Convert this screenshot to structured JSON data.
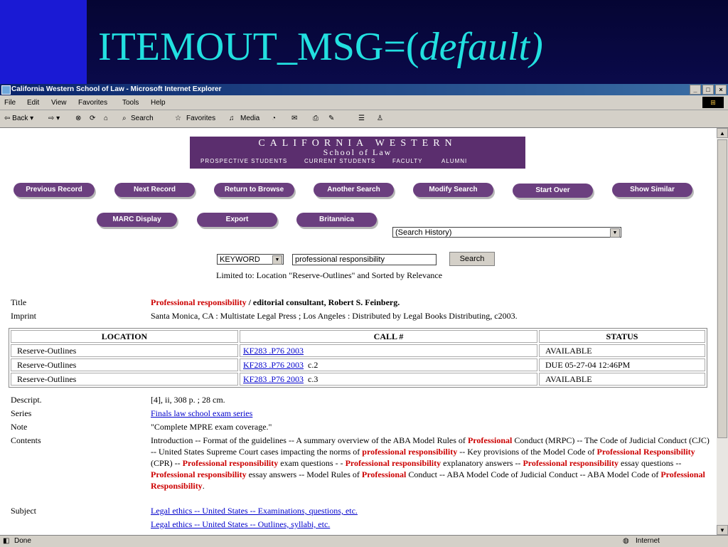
{
  "slide": {
    "title_main": "ITEMOUT_MSG=(",
    "title_italic": "default)"
  },
  "browser": {
    "title": "California Western School of Law - Microsoft Internet Explorer",
    "window_buttons": [
      "_",
      "□",
      "×"
    ],
    "menus": [
      "File",
      "Edit",
      "View",
      "Favorites",
      "Tools",
      "Help"
    ],
    "toolbar": {
      "back": "⇦ Back ▾",
      "forward": "⇨ ▾",
      "search": "Search",
      "favorites": "Favorites",
      "media": "Media"
    },
    "status_left": "Done",
    "status_zone": "Internet"
  },
  "banner": {
    "line1": "CALIFORNIA WESTERN",
    "line2": "School of Law",
    "nav": [
      "PROSPECTIVE STUDENTS",
      "CURRENT STUDENTS",
      "FACULTY",
      "ALUMNI"
    ]
  },
  "buttons": {
    "previous_record": "Previous Record",
    "next_record": "Next Record",
    "return_to_browse": "Return to Browse",
    "another_search": "Another Search",
    "modify_search": "Modify Search",
    "start_over": "Start Over",
    "show_similar": "Show Similar",
    "marc_display": "MARC Display",
    "export": "Export",
    "britannica": "Britannica"
  },
  "search_history": {
    "selected": "(Search History)"
  },
  "search": {
    "type": "KEYWORD",
    "query": "professional responsibility",
    "button": "Search",
    "limit_note": "Limited to: Location \"Reserve-Outlines\" and Sorted by Relevance"
  },
  "record": {
    "title_label": "Title",
    "title_red": "Professional responsibility",
    "title_rest": " / editorial consultant, Robert S. Feinberg.",
    "imprint_label": "Imprint",
    "imprint": "Santa Monica, CA : Multistate Legal Press ; Los Angeles : Distributed by Legal Books Distributing, c2003."
  },
  "holdings": {
    "headers": [
      "LOCATION",
      "CALL #",
      "STATUS"
    ],
    "rows": [
      {
        "location": "Reserve-Outlines",
        "call": "KF283 .P76 2003",
        "copy": "",
        "status": "AVAILABLE"
      },
      {
        "location": "Reserve-Outlines",
        "call": "KF283 .P76 2003",
        "copy": "c.2",
        "status": "DUE 05-27-04 12:46PM"
      },
      {
        "location": "Reserve-Outlines",
        "call": "KF283 .P76 2003",
        "copy": "c.3",
        "status": "AVAILABLE"
      }
    ]
  },
  "details": {
    "descript_label": "Descript.",
    "descript": "[4], ii, 308 p. ; 28 cm.",
    "series_label": "Series",
    "series": "Finals law school exam series",
    "note_label": "Note",
    "note": "\"Complete MPRE exam coverage.\"",
    "contents_label": "Contents",
    "contents_parts": [
      "Introduction -- Format of the guidelines -- A summary overview of the ABA Model Rules of ",
      "Professional",
      " Conduct (MRPC) -- The Code of Judicial Conduct (CJC) -- United States Supreme Court cases impacting the norms of ",
      "professional responsibility",
      " -- Key provisions of the Model Code of ",
      "Professional Responsibility",
      " (CPR) -- ",
      "Professional responsibility",
      " exam questions - - ",
      "Professional responsibility",
      " explanatory answers -- ",
      "Professional responsibility",
      " essay questions -- ",
      "Professional responsibility",
      " essay answers -- Model Rules of ",
      "Professional",
      " Conduct -- ABA Model Code of Judicial Conduct -- ABA Model Code of ",
      "Professional Responsibility",
      "."
    ],
    "subject_label": "Subject",
    "subjects": [
      "Legal ethics -- United States -- Examinations, questions, etc.",
      "Legal ethics -- United States -- Outlines, syllabi, etc."
    ]
  }
}
